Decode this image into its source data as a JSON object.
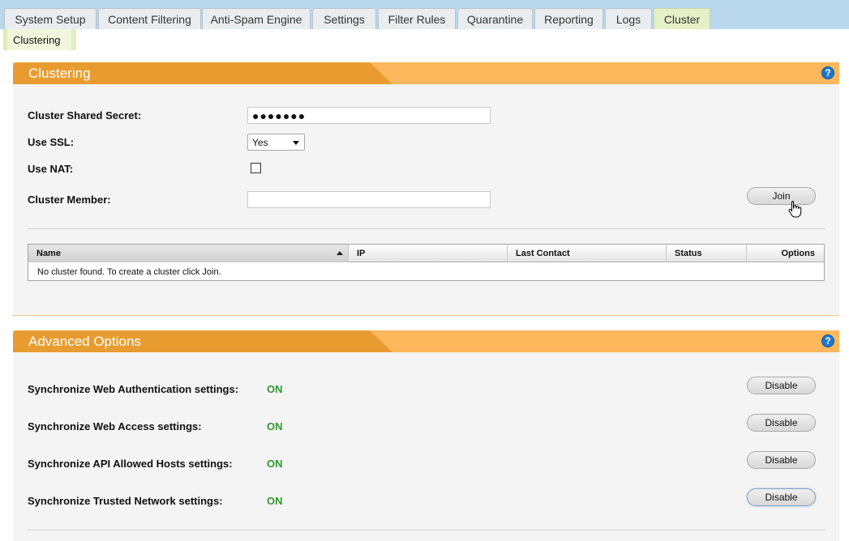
{
  "tabs": [
    {
      "label": "System Setup"
    },
    {
      "label": "Content Filtering"
    },
    {
      "label": "Anti-Spam Engine"
    },
    {
      "label": "Settings"
    },
    {
      "label": "Filter Rules"
    },
    {
      "label": "Quarantine"
    },
    {
      "label": "Reporting"
    },
    {
      "label": "Logs"
    },
    {
      "label": "Cluster",
      "active": true
    }
  ],
  "subtab": {
    "label": "Clustering"
  },
  "clustering": {
    "title": "Clustering",
    "help_icon": "question-icon",
    "help_text": "?",
    "secret_label": "Cluster Shared Secret:",
    "secret_value": "●●●●●●●",
    "ssl_label": "Use SSL:",
    "ssl_value": "Yes",
    "nat_label": "Use NAT:",
    "nat_checked": false,
    "member_label": "Cluster Member:",
    "member_value": "",
    "join_label": "Join",
    "table": {
      "columns": [
        "Name",
        "IP",
        "Last Contact",
        "Status",
        "Options"
      ],
      "empty_text": "No cluster found. To create a cluster click Join."
    }
  },
  "advanced": {
    "title": "Advanced Options",
    "help_text": "?",
    "rows": [
      {
        "label": "Synchronize Web Authentication settings:",
        "status": "ON",
        "button": "Disable"
      },
      {
        "label": "Synchronize Web Access settings:",
        "status": "ON",
        "button": "Disable"
      },
      {
        "label": "Synchronize API Allowed Hosts settings:",
        "status": "ON",
        "button": "Disable"
      },
      {
        "label": "Synchronize Trusted Network settings:",
        "status": "ON",
        "button": "Disable"
      }
    ]
  },
  "colors": {
    "tabbar": "#b9d8ee",
    "header_dark": "#e89c30",
    "header_light": "#fdb75c",
    "status_on": "#2d9a2d"
  }
}
